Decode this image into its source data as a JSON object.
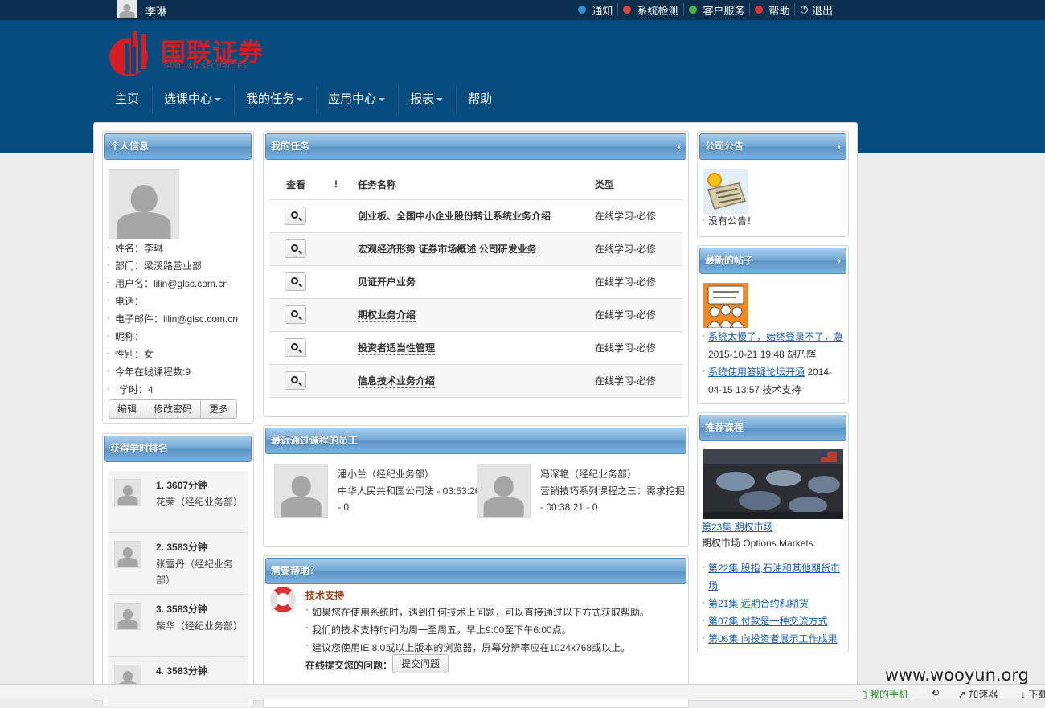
{
  "topbar": {
    "username": "李琳",
    "links": [
      {
        "label": "通知",
        "icon": "notice-icon",
        "color": "#3a8bd6"
      },
      {
        "label": "系统检测",
        "icon": "system-check-icon",
        "color": "#e04545"
      },
      {
        "label": "客户服务",
        "icon": "customer-service-icon",
        "color": "#4caf50"
      },
      {
        "label": "帮助",
        "icon": "help-icon",
        "color": "#d9363e"
      },
      {
        "label": "退出",
        "icon": "power-icon",
        "color": "#ffffff"
      }
    ]
  },
  "brand": {
    "name": "国联证券",
    "sub": "GUOLIAN SECURITIES",
    "color": "#d51d24"
  },
  "nav": [
    {
      "label": "主页",
      "dropdown": false
    },
    {
      "label": "选课中心",
      "dropdown": true
    },
    {
      "label": "我的任务",
      "dropdown": true
    },
    {
      "label": "应用中心",
      "dropdown": true
    },
    {
      "label": "报表",
      "dropdown": true
    },
    {
      "label": "帮助",
      "dropdown": false
    }
  ],
  "profile": {
    "title": "个人信息",
    "fields": [
      "姓名：李琳",
      "部门：梁溪路营业部",
      "用户名：lilin@glsc.com.cn",
      "电话：",
      "电子邮件：lilin@glsc.com.cn",
      "昵称：",
      "性别：女",
      "今年在线课程数:9",
      "学时：4"
    ],
    "buttons": [
      "编辑",
      "修改密码",
      "更多"
    ]
  },
  "ranking": {
    "title": "获得学时排名",
    "items": [
      {
        "title": "1.  3607分钟",
        "name": "花荣（经纪业务部）"
      },
      {
        "title": "2.  3583分钟",
        "name": "张雪丹（经纪业务部）"
      },
      {
        "title": "3.  3583分钟",
        "name": "柴华（经纪业务部）"
      },
      {
        "title": "4.  3583分钟",
        "name": ""
      }
    ]
  },
  "tasks": {
    "title": "我的任务",
    "headers": {
      "view": "查看",
      "flag": "!",
      "name": "任务名称",
      "type": "类型"
    },
    "rows": [
      {
        "name": "创业板、全国中小企业股份转让系统业务介绍",
        "type": "在线学习-必修"
      },
      {
        "name": "宏观经济形势 证券市场概述 公司研发业务",
        "type": "在线学习-必修"
      },
      {
        "name": "见证开户业务",
        "type": "在线学习-必修"
      },
      {
        "name": "期权业务介绍",
        "type": "在线学习-必修"
      },
      {
        "name": "投资者适当性管理",
        "type": "在线学习-必修"
      },
      {
        "name": "信息技术业务介绍",
        "type": "在线学习-必修"
      }
    ]
  },
  "recent": {
    "title": "最近通过课程的员工",
    "items": [
      {
        "name": "潘小兰（经纪业务部）",
        "desc": "中华人民共和国公司法 - 03:53:26 - 0"
      },
      {
        "name": "冯深艳（经纪业务部）",
        "desc": "营销技巧系列课程之三：需求挖掘 - 00:38:21 - 0"
      }
    ]
  },
  "help": {
    "title": "需要帮助？",
    "subtitle": "技术支持",
    "lines": [
      "如果您在使用系统时，遇到任何技术上问题，可以直接通过以下方式获取帮助。",
      "我们的技术支持时间为周一至周五，早上9:00至下午6:00点。",
      "建议您使用IE 8.0或以上版本的浏览器，屏幕分辨率应在1024x768或以上。"
    ],
    "question_label": "在线提交您的问题：",
    "submit": "提交问题"
  },
  "announce": {
    "title": "公司公告",
    "empty": "没有公告！"
  },
  "posts": {
    "title": "最新的帖子",
    "items": [
      {
        "link": "系统太慢了，始终登录不了，急",
        "meta": "2015-10-21 19:48  胡乃辉"
      },
      {
        "link": "系统使用答疑论坛开通",
        "meta": "2014-04-15 13:57  技术支持"
      }
    ]
  },
  "courses": {
    "title": "推荐课程",
    "featured": {
      "link": "第23集 期权市场",
      "caption": "期权市场 Options Markets"
    },
    "items": [
      "第22集 股指,石油和其他期货市场",
      "第21集 远期合约和期货",
      "第07集 付款是一种交流方式",
      "第06集 向投资者展示工作成果"
    ]
  },
  "watermark": "www.wooyun.org",
  "statusbar": {
    "phone": "我的手机",
    "accelerator": "加速器",
    "download": "下载"
  }
}
